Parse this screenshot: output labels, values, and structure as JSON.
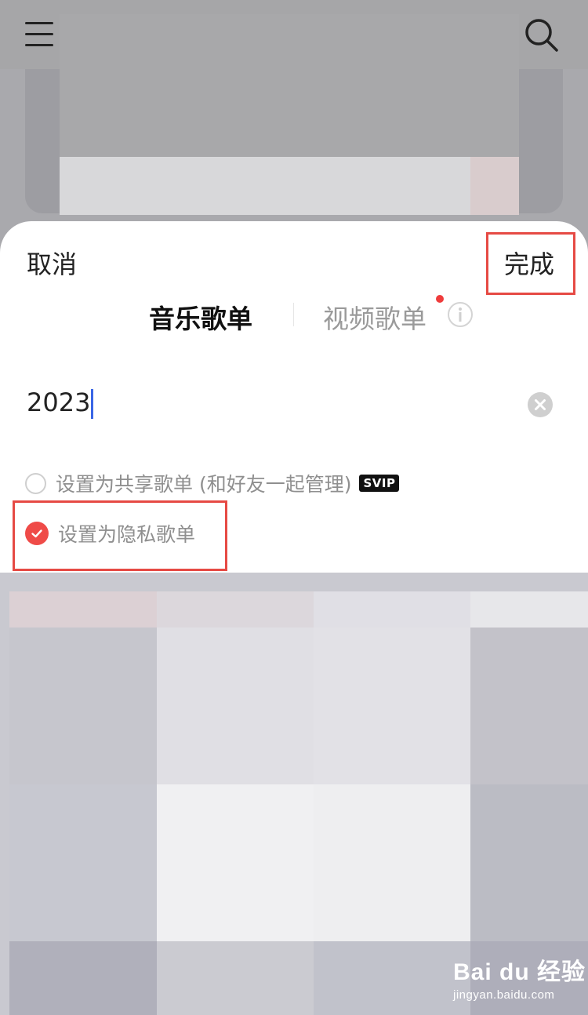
{
  "header": {
    "menu_icon": "menu-icon",
    "search_icon": "search-icon"
  },
  "sheet": {
    "cancel_label": "取消",
    "done_label": "完成",
    "tabs": [
      {
        "label": "音乐歌单",
        "selected": true
      },
      {
        "label": "视频歌单",
        "selected": false,
        "has_red_dot": true
      }
    ],
    "info_icon": "info-icon",
    "name_input": {
      "value": "2023"
    },
    "clear_icon": "clear-icon",
    "options": [
      {
        "label": "设置为共享歌单 (和好友一起管理)",
        "checked": false,
        "badge": "SVIP"
      },
      {
        "label": "设置为隐私歌单",
        "checked": true
      }
    ]
  },
  "watermark": {
    "main": "Bai du 经验",
    "sub": "jingyan.baidu.com"
  },
  "colors": {
    "accent_red": "#ef4b48",
    "annotation_red": "#e64a44",
    "caret_blue": "#3a66e6"
  }
}
